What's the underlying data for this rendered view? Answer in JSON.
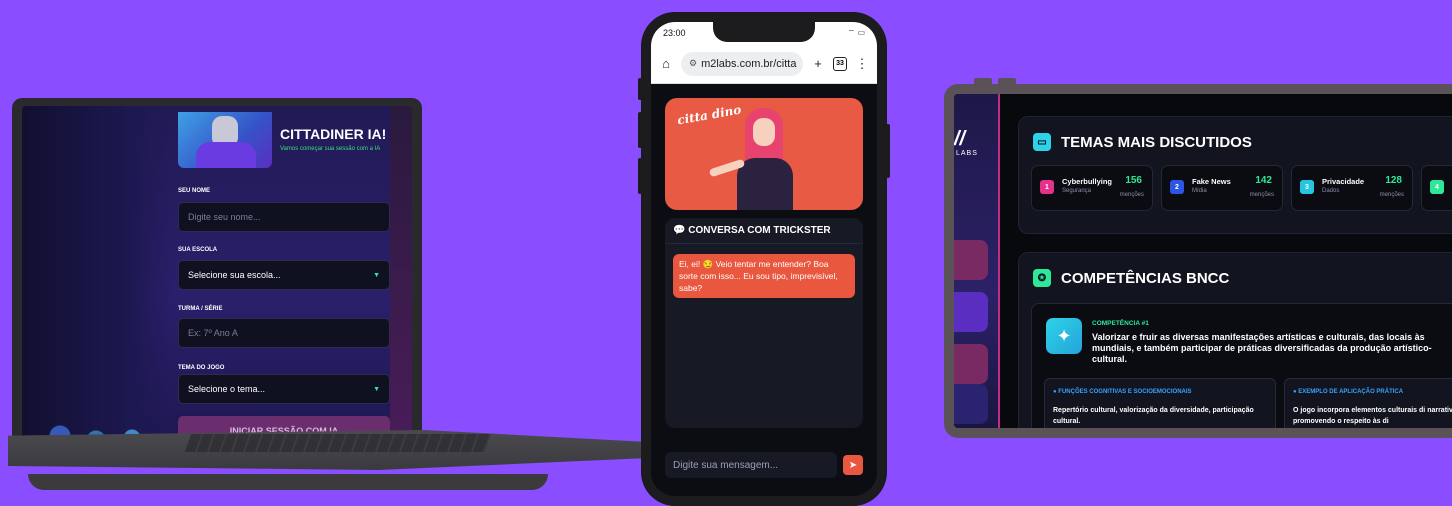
{
  "laptop": {
    "title": "CITTADINER IA!",
    "subtitle": "Vamos começar sua sessão com a IA",
    "fields": [
      {
        "label": "SEU NOME",
        "value": "Digite seu nome..."
      },
      {
        "label": "SUA ESCOLA",
        "value": "Selecione sua escola..."
      },
      {
        "label": "TURMA / SÉRIE",
        "value": "Ex: 7º Ano A"
      },
      {
        "label": "TEMA DO JOGO",
        "value": "Selecione o tema..."
      }
    ],
    "dropdown_arrow": "▼",
    "start_button": "INICIAR SESSÃO COM IA"
  },
  "phone": {
    "time": "23:00",
    "status_icons": "wifi-icon battery-icon",
    "url": "m2labs.com.br/citta",
    "tab_count": "33",
    "banner_logo": "citta dino",
    "chat_title": "💬 CONVERSA COM TRICKSTER",
    "bot_message": "Ei, ei! 😏 Veio tentar me entender? Boa sorte com isso... Eu sou tipo, imprevisível, sabe?",
    "input_placeholder": "Digite sua mensagem...",
    "send_icon": "send-icon"
  },
  "tablet": {
    "logo": "//",
    "logo_sub": "LABS",
    "topics_title": "TEMAS MAIS DISCUTIDOS",
    "topics": [
      {
        "rank": "1",
        "name": "Cyberbullying",
        "category": "Segurança",
        "count": "156",
        "unit": "menções",
        "color": "#e6318b"
      },
      {
        "rank": "2",
        "name": "Fake News",
        "category": "Mídia",
        "count": "142",
        "unit": "menções",
        "color": "#2b55e6"
      },
      {
        "rank": "3",
        "name": "Privacidade",
        "category": "Dados",
        "count": "128",
        "unit": "menções",
        "color": "#26c6e0"
      },
      {
        "rank": "4",
        "name": "",
        "category": "",
        "count": "",
        "unit": "",
        "color": "#2ee89a"
      }
    ],
    "bncc_title": "COMPETÊNCIAS BNCC",
    "competency": {
      "number": "COMPETÊNCIA #1",
      "text": "Valorizar e fruir as diversas manifestações artísticas e culturais, das locais às mundiais, e também participar de práticas diversificadas da produção artístico-cultural."
    },
    "sub_cards": [
      {
        "title": "● FUNÇÕES COGNITIVAS E SOCIOEMOCIONAIS",
        "text": "Repertório cultural, valorização da diversidade, participação cultural."
      },
      {
        "title": "● EXEMPLO DE APLICAÇÃO PRÁTICA",
        "text": "O jogo incorpora elementos culturais di narrativas, promovendo o respeito às di"
      }
    ]
  }
}
